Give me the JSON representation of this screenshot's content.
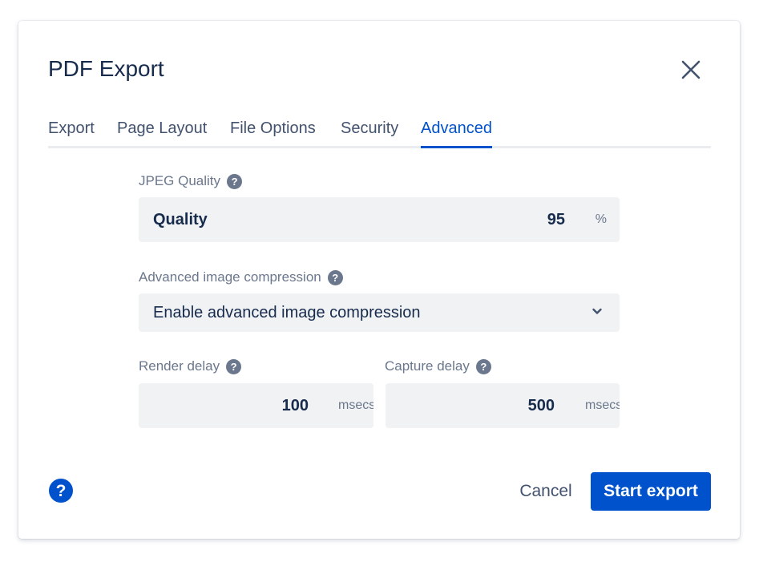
{
  "dialog": {
    "title": "PDF Export"
  },
  "tabs": [
    {
      "label": "Export"
    },
    {
      "label": "Page Layout"
    },
    {
      "label": "File Options"
    },
    {
      "label": "Security"
    },
    {
      "label": "Advanced",
      "active": true
    }
  ],
  "jpeg_quality": {
    "label": "JPEG Quality",
    "field_label": "Quality",
    "value": "95",
    "unit": "%"
  },
  "compression": {
    "label": "Advanced image compression",
    "selected": "Enable advanced image compression"
  },
  "render_delay": {
    "label": "Render delay",
    "value": "100",
    "unit": "msecs"
  },
  "capture_delay": {
    "label": "Capture delay",
    "value": "500",
    "unit": "msecs"
  },
  "footer": {
    "cancel_label": "Cancel",
    "start_label": "Start export"
  },
  "icons": {
    "close": "close-icon",
    "help": "question-circle-icon",
    "dropdown": "chevron-down-icon"
  },
  "colors": {
    "accent": "#0052cc",
    "text": "#172b4d",
    "muted": "#6b778c",
    "field_bg": "#f1f2f4"
  }
}
